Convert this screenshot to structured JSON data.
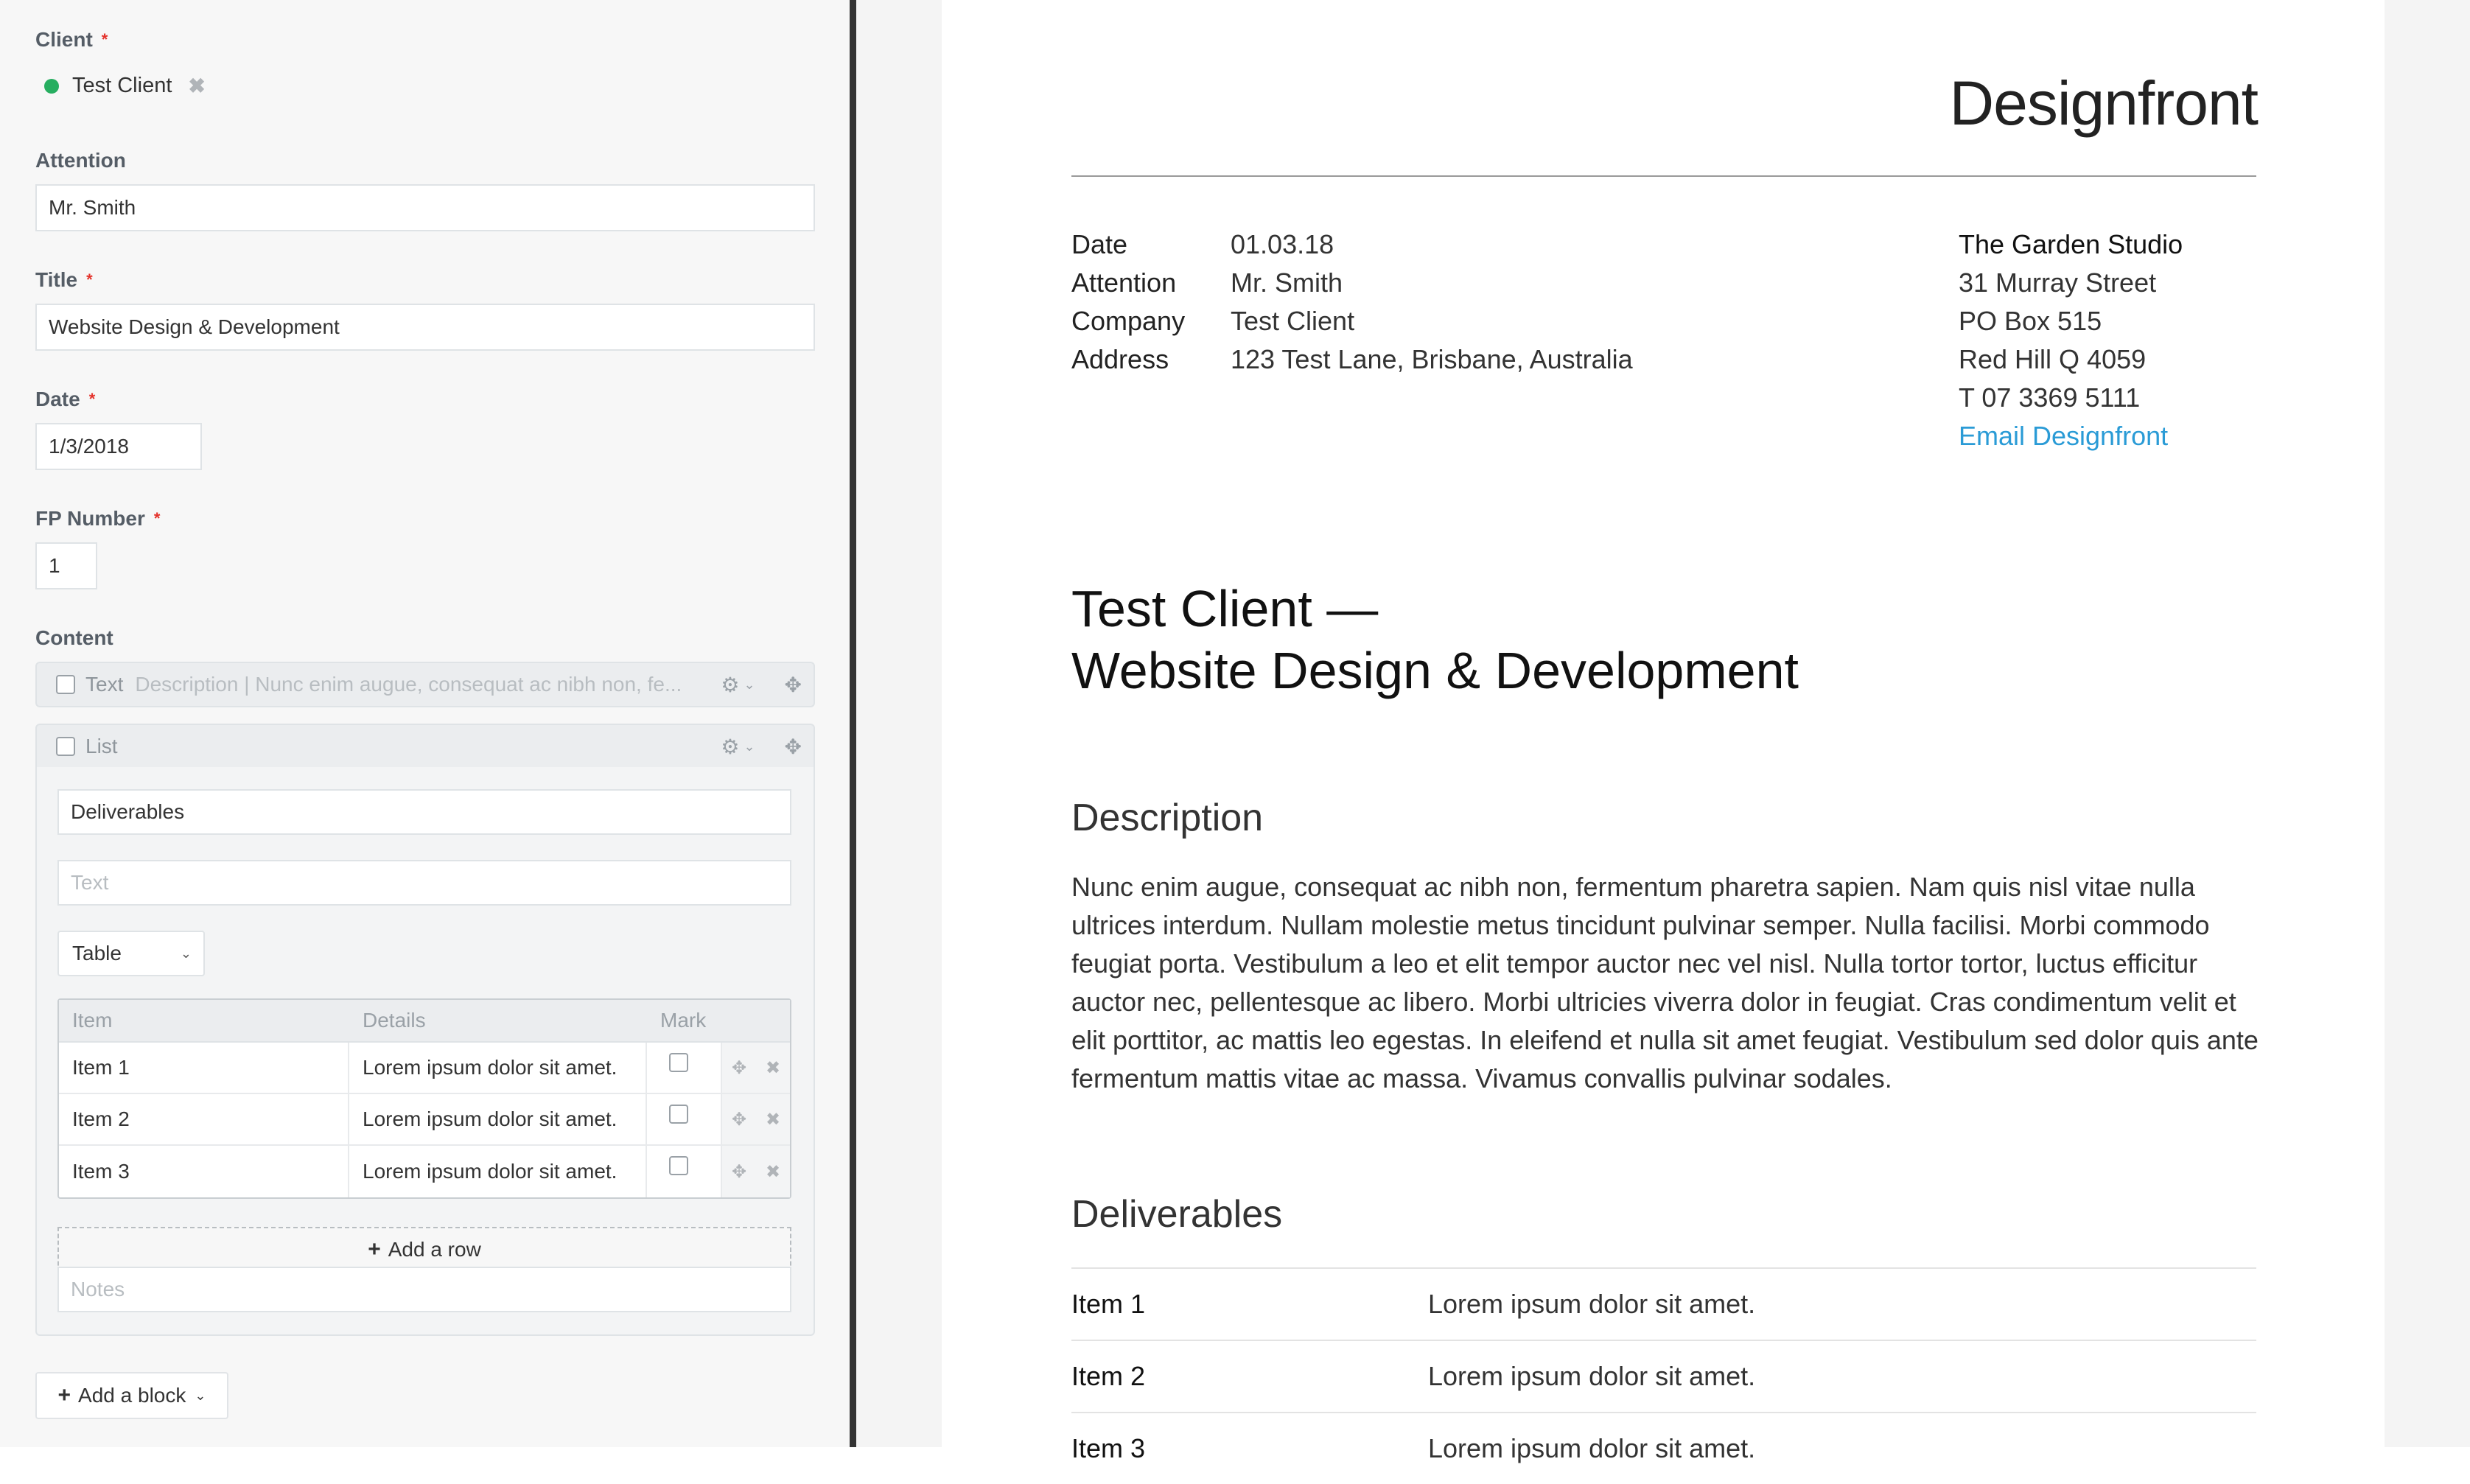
{
  "editor": {
    "client": {
      "label": "Client",
      "value": "Test Client"
    },
    "attention": {
      "label": "Attention",
      "value": "Mr. Smith"
    },
    "title": {
      "label": "Title",
      "value": "Website Design & Development"
    },
    "date": {
      "label": "Date",
      "value": "1/3/2018"
    },
    "fp_number": {
      "label": "FP Number",
      "value": "1"
    },
    "content_label": "Content",
    "required_mark": "*",
    "text_block": {
      "type": "Text",
      "summary": "Description | Nunc enim augue, consequat ac nibh non, fe..."
    },
    "list_block": {
      "type": "List",
      "heading_value": "Deliverables",
      "text_placeholder": "Text",
      "display_select": "Table",
      "columns": [
        "Item",
        "Details",
        "Mark"
      ],
      "rows": [
        {
          "item": "Item 1",
          "details": "Lorem ipsum dolor sit amet."
        },
        {
          "item": "Item 2",
          "details": "Lorem ipsum dolor sit amet."
        },
        {
          "item": "Item 3",
          "details": "Lorem ipsum dolor sit amet."
        }
      ],
      "add_row_label": "Add a row",
      "notes_placeholder": "Notes"
    },
    "add_block_label": "Add a block"
  },
  "preview": {
    "brand": "Designfront",
    "meta": [
      {
        "key": "Date",
        "value": "01.03.18"
      },
      {
        "key": "Attention",
        "value": "Mr. Smith"
      },
      {
        "key": "Company",
        "value": "Test Client"
      },
      {
        "key": "Address",
        "value": "123 Test Lane, Brisbane, Australia"
      }
    ],
    "studio": {
      "name": "The Garden Studio",
      "street": "31 Murray Street",
      "po_box": "PO Box 515",
      "suburb": "Red Hill Q 4059",
      "phone": "T 07 3369 5111",
      "email_link": "Email Designfront"
    },
    "title_line1": "Test Client —",
    "title_line2": "Website Design & Development",
    "description_heading": "Description",
    "description_body": "Nunc enim augue, consequat ac nibh non, fermentum pharetra sapien. Nam quis nisl vitae nulla ultrices interdum. Nullam molestie metus tincidunt pulvinar semper. Nulla facilisi. Morbi commodo feugiat porta. Vestibulum a leo et elit tempor auctor nec vel nisl. Nulla tortor tortor, luctus efficitur auctor nec, pellentesque ac libero. Morbi ultricies viverra dolor in feugiat. Cras condimentum velit et elit porttitor, ac mattis leo egestas. In eleifend et nulla sit amet feugiat. Vestibulum sed dolor quis ante fermentum mattis vitae ac massa. Vivamus convallis pulvinar sodales.",
    "deliverables_heading": "Deliverables",
    "deliverables": [
      {
        "item": "Item 1",
        "details": "Lorem ipsum dolor sit amet."
      },
      {
        "item": "Item 2",
        "details": "Lorem ipsum dolor sit amet."
      },
      {
        "item": "Item 3",
        "details": "Lorem ipsum dolor sit amet."
      }
    ]
  },
  "colors": {
    "status_green": "#27ae60",
    "required_red": "#e4322b",
    "link_blue": "#2a9bd6",
    "divider": "#333333"
  }
}
